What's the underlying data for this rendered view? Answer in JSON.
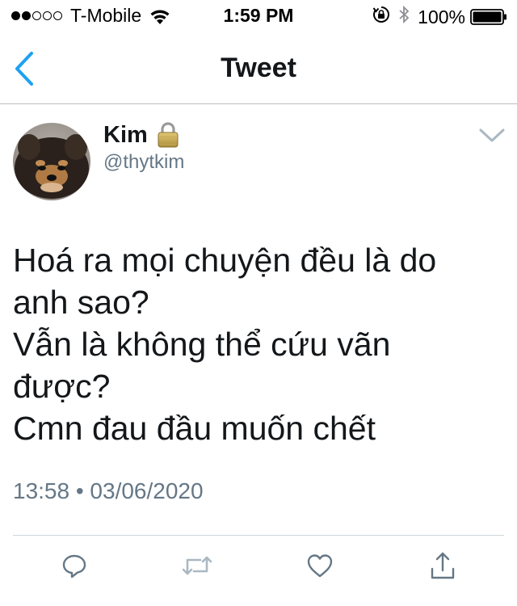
{
  "status_bar": {
    "signal_full": 2,
    "signal_total": 5,
    "carrier": "T-Mobile",
    "time": "1:59 PM",
    "battery": "100%"
  },
  "nav": {
    "title": "Tweet",
    "back_icon": "chevron-left-icon",
    "accent_color": "#1da1f2"
  },
  "tweet": {
    "author": {
      "display_name": "Kim",
      "handle": "@thytkim",
      "protected_icon": "padlock-icon"
    },
    "text_lines": [
      "Hoá ra mọi chuyện đều là do",
      "anh sao?",
      "Vẫn là không thể cứu vãn",
      "được?",
      "Cmn đau đầu muốn chết"
    ],
    "timestamp": "13:58 • 03/06/2020"
  },
  "actions": [
    {
      "name": "reply",
      "icon": "reply-icon"
    },
    {
      "name": "retweet",
      "icon": "retweet-icon"
    },
    {
      "name": "like",
      "icon": "heart-icon"
    },
    {
      "name": "share",
      "icon": "share-icon"
    }
  ],
  "colors": {
    "text_primary": "#14171a",
    "text_secondary": "#657786",
    "icon_gray": "#657786"
  }
}
